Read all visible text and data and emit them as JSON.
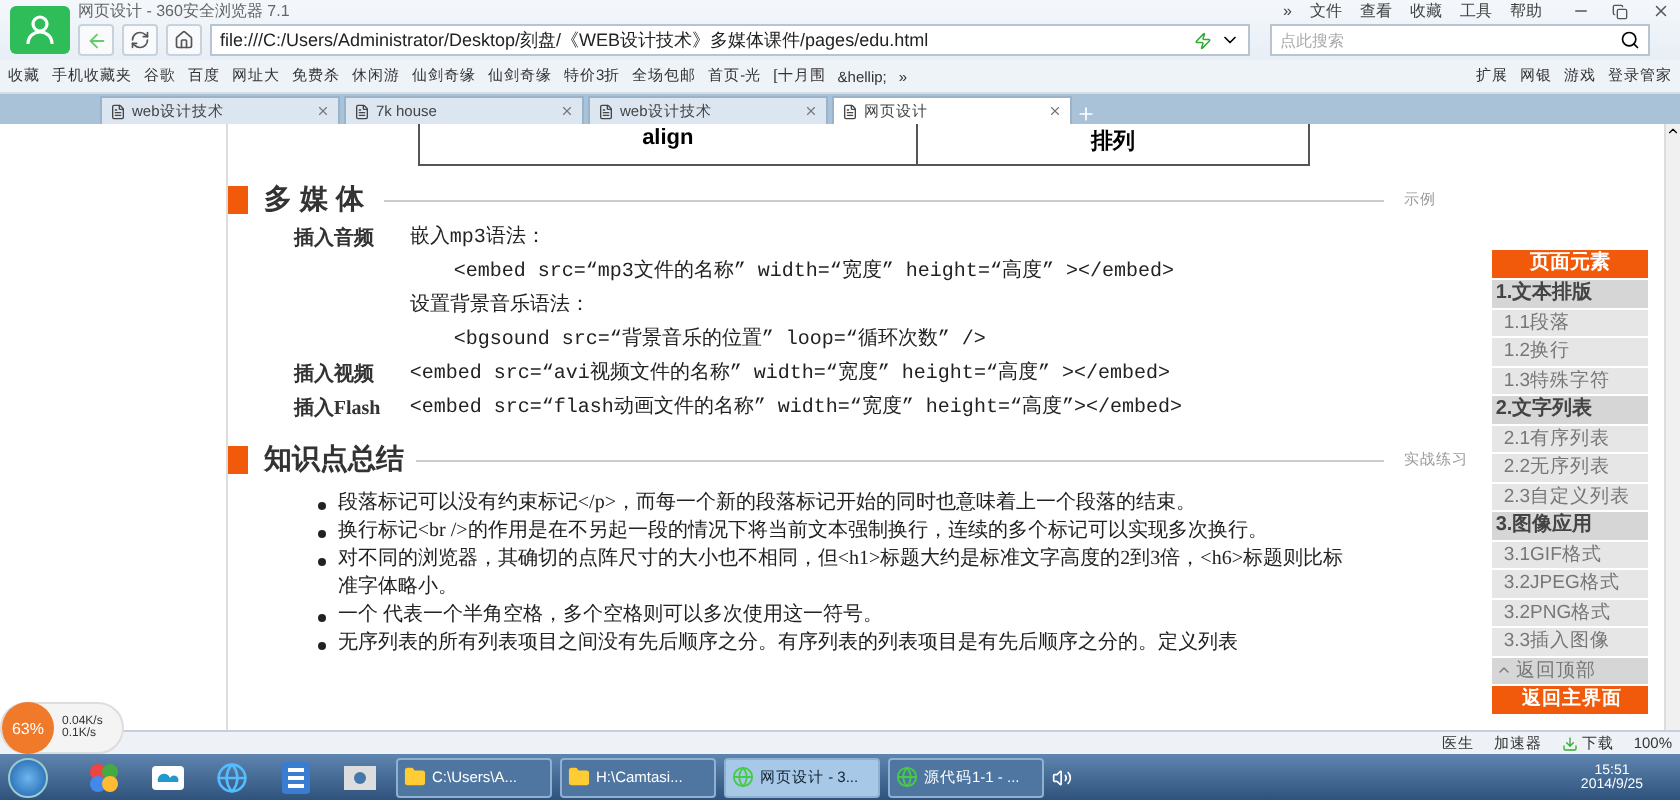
{
  "window": {
    "title": "网页设计 - 360安全浏览器 7.1",
    "menu": [
      "»",
      "文件",
      "查看",
      "收藏",
      "工具",
      "帮助"
    ]
  },
  "address": {
    "url": "file:///C:/Users/Administrator/Desktop/刻盘/《WEB设计技术》多媒体课件/pages/edu.html",
    "search_placeholder": "点此搜索"
  },
  "bookmarks": [
    "收藏",
    "手机收藏夹",
    "谷歌",
    "百度",
    "网址大",
    "免费杀",
    "休闲游",
    "仙剑奇缘",
    "仙剑奇缘",
    "特价3折",
    "全场包邮",
    "首页-光",
    "[十月围",
    "&hellip;",
    "»"
  ],
  "bookmark_tools": [
    "扩展",
    "网银",
    "游戏",
    "登录管家"
  ],
  "tabs": [
    {
      "label": "web设计技术",
      "selected": false
    },
    {
      "label": "7k house",
      "selected": false
    },
    {
      "label": "web设计技术",
      "selected": false
    },
    {
      "label": "网页设计",
      "selected": true
    }
  ],
  "table_row": [
    "align",
    "排列"
  ],
  "multimedia": {
    "title": "多媒体",
    "link": "示例",
    "rows": [
      {
        "label": "插入音频",
        "lines": [
          {
            "kind": "note",
            "text": "嵌入mp3语法："
          },
          {
            "kind": "code",
            "text": "<embed src=“mp3文件的名称” width=“宽度” height=“高度” ></embed>"
          },
          {
            "kind": "note",
            "text": "设置背景音乐语法："
          },
          {
            "kind": "code",
            "text": "<bgsound src=“背景音乐的位置” loop=“循环次数” />"
          }
        ]
      },
      {
        "label": "插入视频",
        "lines": [
          {
            "kind": "note",
            "text": "<embed src=“avi视频文件的名称” width=“宽度” height=“高度” ></embed>"
          }
        ]
      },
      {
        "label": "插入Flash",
        "lines": [
          {
            "kind": "note",
            "text": "<embed src=“flash动画文件的名称” width=“宽度” height=“高度”></embed>"
          }
        ]
      }
    ]
  },
  "summary": {
    "title": "知识点总结",
    "link": "实战练习",
    "bullets": [
      "段落标记可以没有约束标记</p>，而每一个新的段落标记开始的同时也意味着上一个段落的结束。",
      "换行标记<br />的作用是在不另起一段的情况下将当前文本强制换行，连续的多个标记可以实现多次换行。",
      "对不同的浏览器，其确切的点阵尺寸的大小也不相同，但<h1>标题大约是标准文字高度的2到3倍，<h6>标题则比标准字体略小。",
      "一个 代表一个半角空格，多个空格则可以多次使用这一符号。",
      "无序列表的所有列表项目之间没有先后顺序之分。有序列表的列表项目是有先后顺序之分的。定义列表"
    ]
  },
  "nav": {
    "title": "页面元素",
    "items": [
      {
        "kind": "group",
        "label": "1.文本排版"
      },
      {
        "kind": "item",
        "label": "1.1段落"
      },
      {
        "kind": "item",
        "label": "1.2换行"
      },
      {
        "kind": "item",
        "label": "1.3特殊字符"
      },
      {
        "kind": "group",
        "label": "2.文字列表"
      },
      {
        "kind": "item",
        "label": "2.1有序列表"
      },
      {
        "kind": "item",
        "label": "2.2无序列表"
      },
      {
        "kind": "item",
        "label": "2.3自定义列表"
      },
      {
        "kind": "group",
        "label": "3.图像应用"
      },
      {
        "kind": "item",
        "label": "3.1GIF格式"
      },
      {
        "kind": "item",
        "label": "3.2JPEG格式"
      },
      {
        "kind": "item",
        "label": "3.2PNG格式"
      },
      {
        "kind": "item",
        "label": "3.3插入图像"
      },
      {
        "kind": "back",
        "label": "返回顶部"
      },
      {
        "kind": "home",
        "label": "返回主界面"
      }
    ]
  },
  "net_meter": {
    "percent": "63%",
    "up": "0.04K/s",
    "down": "0.1K/s"
  },
  "status_bar": [
    "医生",
    "加速器",
    "下载",
    "100%"
  ],
  "taskbar": {
    "tasks": [
      {
        "label": "C:\\Users\\A...",
        "kind": "folder",
        "selected": false
      },
      {
        "label": "H:\\Camtasi...",
        "kind": "folder",
        "selected": false
      },
      {
        "label": "网页设计 - 3...",
        "kind": "browser",
        "selected": true
      },
      {
        "label": "源代码1-1 - ...",
        "kind": "browser",
        "selected": false
      }
    ],
    "time": "15:51",
    "date": "2014/9/25"
  }
}
